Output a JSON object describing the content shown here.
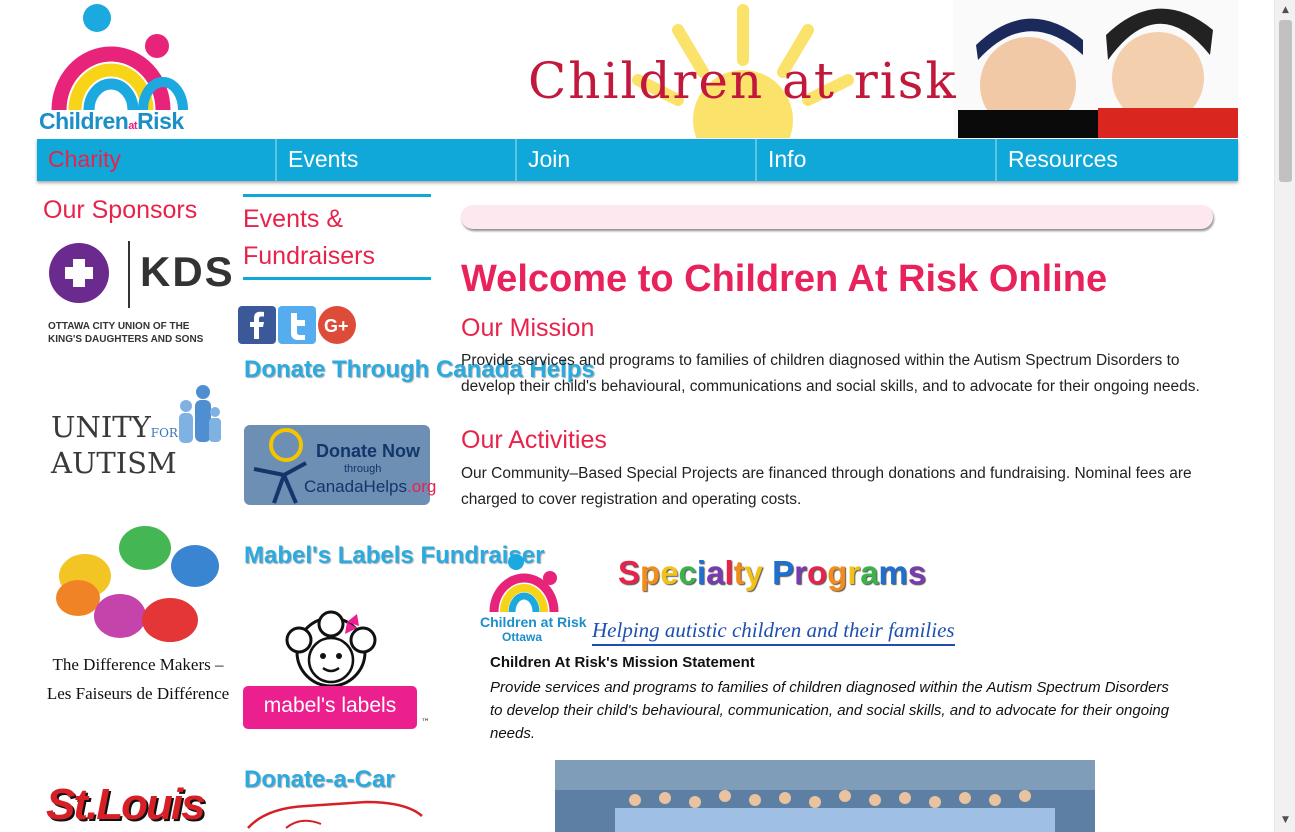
{
  "header": {
    "logo_text_main_1": "Children",
    "logo_text_small": "at",
    "logo_text_main_2": "Risk",
    "banner_text": "Children at risk"
  },
  "nav": {
    "items": [
      {
        "label": "Charity",
        "active": true
      },
      {
        "label": "Events",
        "active": false
      },
      {
        "label": "Join",
        "active": false
      },
      {
        "label": "Info",
        "active": false
      },
      {
        "label": "Resources",
        "active": false
      }
    ]
  },
  "sponsors": {
    "title": "Our Sponsors",
    "kds": {
      "letters": "KDS",
      "caption_line1": "OTTAWA CITY UNION OF THE",
      "caption_line2": "KING'S DAUGHTERS AND SONS"
    },
    "unity": {
      "line1": "UNITY",
      "for": "FOR",
      "line2": "AUTISM"
    },
    "difference_makers": "The Difference Makers – Les Faiseurs de Différence",
    "stlouis": "St.Louis"
  },
  "sidebar": {
    "events_title": "Events & Fundraisers",
    "donate_canada_heading": "Donate Through Canada Helps",
    "canada_helps": {
      "donate_now": "Donate Now",
      "through": "through",
      "site_main": "CanadaHelps",
      "site_suffix": ".org"
    },
    "mabel_heading": "Mabel's Labels Fundraiser",
    "mabel_label": "mabel's labels",
    "mabel_tm": "™",
    "donate_car_heading": "Donate-a-Car"
  },
  "main": {
    "welcome": "Welcome to Children At Risk Online",
    "mission_title": "Our Mission",
    "mission_text": "Provide services and programs to families of children diagnosed within the Autism Spectrum Disorders to develop their child's behavioural, communications and social skills, and to advocate for their ongoing needs.",
    "activities_title": "Our Activities",
    "activities_text": "Our Community–Based Special Projects are financed through donations and fundraising. Nominal fees are charged to cover registration and operating costs."
  },
  "specialty": {
    "logo_text": "Children at Risk",
    "logo_sub": "Ottawa",
    "title_letters": [
      "S",
      "p",
      "e",
      "c",
      "i",
      "a",
      "l",
      "t",
      "y",
      " ",
      "P",
      "r",
      "o",
      "g",
      "r",
      "a",
      "m",
      "s"
    ],
    "subtitle": "Helping autistic children and their families",
    "heading": "Children At Risk's Mission Statement",
    "text": "Provide services and programs to families of children diagnosed within the Autism Spectrum Disorders to develop their child's behavioural, communication, and social skills, and to advocate for their ongoing needs."
  },
  "colors": {
    "nav_bg": "#0fa8d8",
    "accent_pink": "#e8234b",
    "link_blue": "#29abe2"
  }
}
